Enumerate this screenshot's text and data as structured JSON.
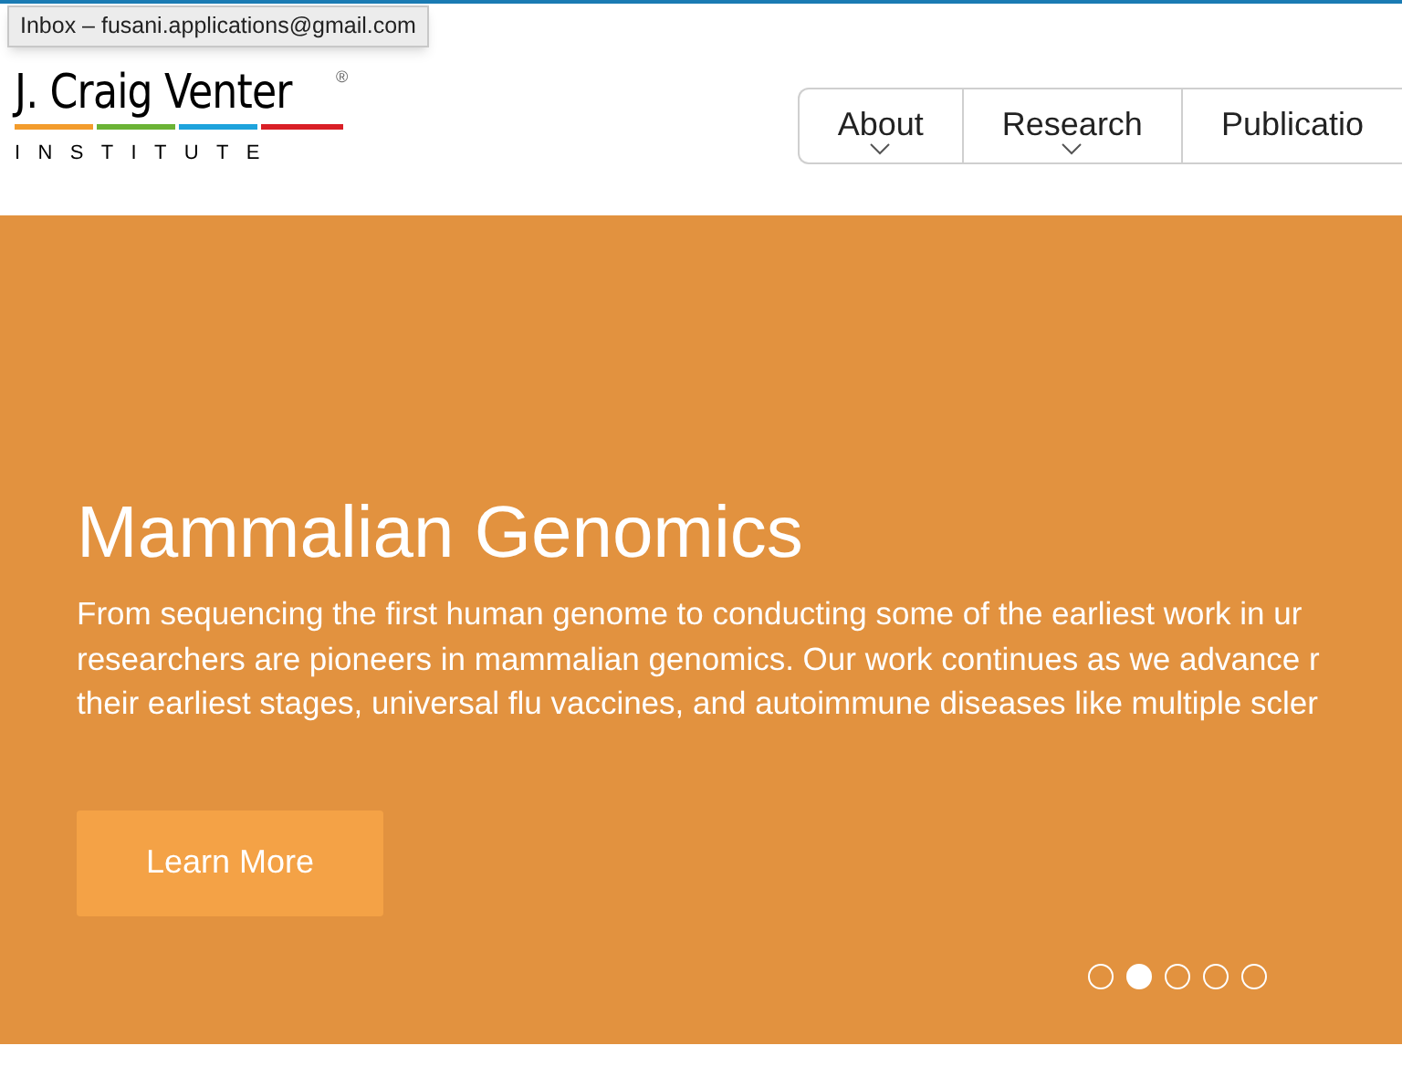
{
  "tooltip": {
    "text": "Inbox – fusani.applications@gmail.com"
  },
  "logo": {
    "name": "J. Craig Venter",
    "mark": "®",
    "subtitle": "INSTITUTE"
  },
  "nav": [
    {
      "label": "About",
      "dropdown": true
    },
    {
      "label": "Research",
      "dropdown": true
    },
    {
      "label": "Publicatio",
      "dropdown": false
    }
  ],
  "hero": {
    "title": "Mammalian Genomics",
    "lines": [
      "From sequencing the first human genome to conducting some of the earliest work in ur",
      "researchers are pioneers in mammalian genomics. Our work continues as we advance r",
      "their earliest stages, universal flu vaccines, and autoimmune diseases like multiple scler"
    ],
    "button": "Learn More",
    "dots": [
      {
        "selected": false
      },
      {
        "selected": true
      },
      {
        "selected": false
      },
      {
        "selected": false
      },
      {
        "selected": false
      }
    ]
  }
}
